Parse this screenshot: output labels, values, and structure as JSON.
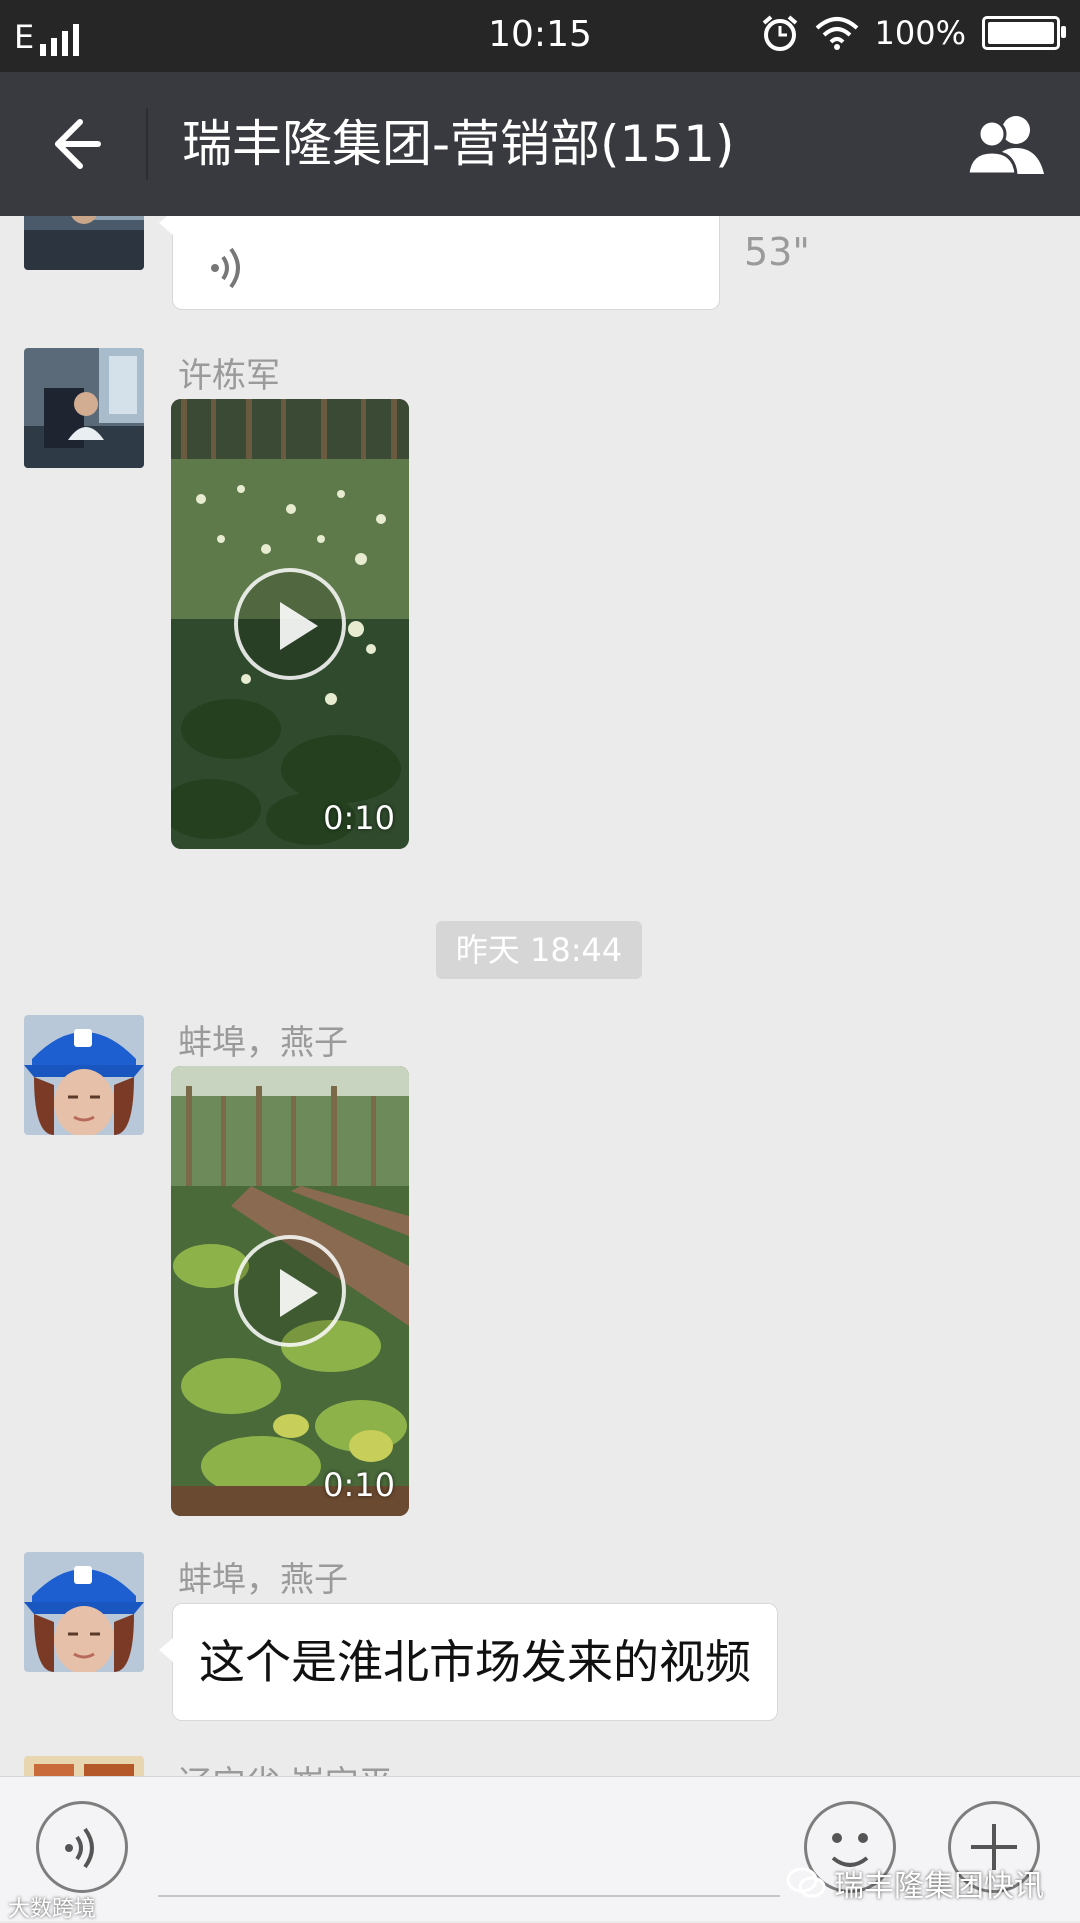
{
  "status_bar": {
    "network": "E",
    "time": "10:15",
    "battery": "100%"
  },
  "header": {
    "title": "瑞丰隆集团-营销部(151)",
    "back_icon": "back-arrow-icon",
    "members_icon": "group-members-icon"
  },
  "messages": [
    {
      "type": "voice",
      "duration": "53\""
    },
    {
      "type": "video",
      "sender": "许栋军",
      "duration": "0:10"
    },
    {
      "type": "timestamp",
      "text": "昨天 18:44"
    },
    {
      "type": "video",
      "sender": "蚌埠，燕子",
      "duration": "0:10"
    },
    {
      "type": "text",
      "sender": "蚌埠，燕子",
      "text": "这个是淮北市场发来的视频"
    },
    {
      "type": "partial",
      "sender": "辽宁省 崔宝平"
    }
  ],
  "input_bar": {
    "voice_icon": "voice-mode-icon",
    "emoji_icon": "emoji-icon",
    "plus_icon": "plus-icon"
  },
  "watermarks": {
    "right": "瑞丰隆集团快讯",
    "left": "大数跨境"
  },
  "colors": {
    "status_bar": "#262626",
    "title_bar": "#393a3f",
    "chat_bg": "#ebebeb"
  }
}
